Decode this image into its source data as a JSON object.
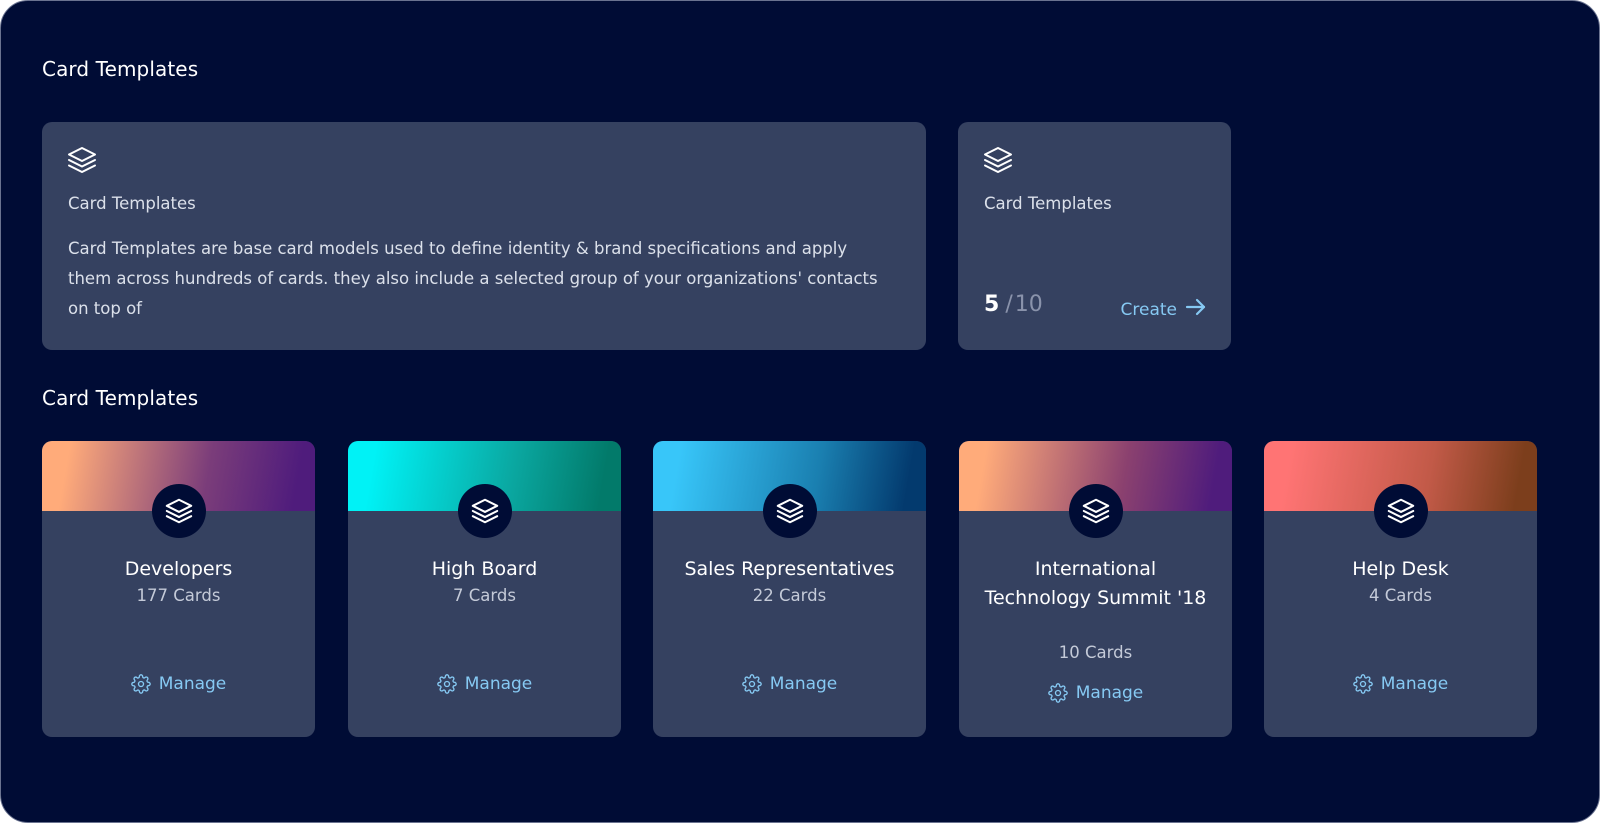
{
  "header": {
    "title": "Card Templates"
  },
  "info": {
    "title": "Card Templates",
    "description": "Card Templates are base card models used to define identity & brand specifications and apply them across hundreds of cards. they also include a selected group of your organizations' contacts on top of"
  },
  "usage": {
    "title": "Card Templates",
    "used": "5",
    "separator": "/",
    "limit": "10",
    "create_label": "Create"
  },
  "list": {
    "title": "Card Templates",
    "manage_label": "Manage",
    "items": [
      {
        "name": "Developers",
        "count": "177 Cards",
        "gradient": [
          "#ffab7a",
          "#7b3d7a",
          "#4f1c7c"
        ]
      },
      {
        "name": "High Board",
        "count": "7 Cards",
        "gradient": [
          "#00f2f6",
          "#0aa7a0",
          "#027a6a"
        ]
      },
      {
        "name": "Sales Representatives",
        "count": "22 Cards",
        "gradient": [
          "#38c6f9",
          "#1a7fb0",
          "#033a6e"
        ]
      },
      {
        "name": "International Technology Summit '18",
        "count": "10 Cards",
        "gradient": [
          "#ffab7a",
          "#8b416f",
          "#4f1c7c"
        ]
      },
      {
        "name": "Help Desk",
        "count": "4 Cards",
        "gradient": [
          "#ff7474",
          "#c25a48",
          "#7c3e1c"
        ]
      }
    ]
  },
  "colors": {
    "background": "#000c35",
    "panel": "#354160",
    "accent": "#86c9f3"
  },
  "icons": {
    "layers": "layers-icon",
    "gear": "gear-icon",
    "arrow": "arrow-right-icon"
  }
}
